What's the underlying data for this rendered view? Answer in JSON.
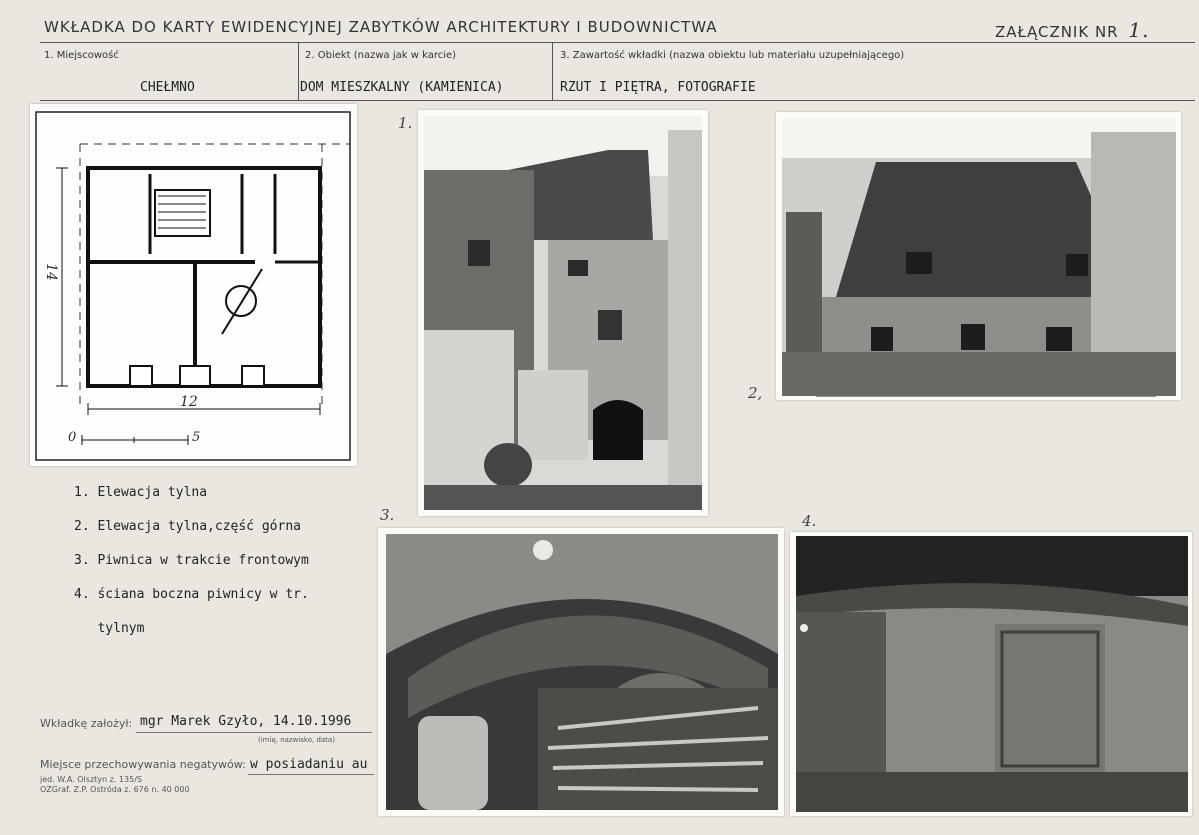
{
  "header": {
    "title": "WKŁADKA DO KARTY EWIDENCYJNEJ ZABYTKÓW ARCHITEKTURY I BUDOWNICTWA",
    "annex_label": "ZAŁĄCZNIK NR",
    "annex_number": "1."
  },
  "fields": {
    "locality_label": "1. Miejscowość",
    "locality_value": "CHEŁMNO",
    "object_label": "2. Obiekt (nazwa jak w karcie)",
    "object_value": "DOM MIESZKALNY (KAMIENICA)",
    "contents_label": "3. Zawartość wkładki (nazwa obiektu lub materiału uzupełniającego)",
    "contents_value": "RZUT I PIĘTRA, FOTOGRAFIE"
  },
  "plan": {
    "dim_vertical": "14",
    "dim_horizontal": "12",
    "scale_start": "0",
    "scale_end": "5"
  },
  "photos": {
    "p1": "1.",
    "p2": "2,",
    "p3": "3.",
    "p4": "4."
  },
  "legend": {
    "items": [
      "1. Elewacja tylna",
      "2. Elewacja tylna,część górna",
      "3. Piwnica w trakcie frontowym",
      "4. ściana boczna piwnicy w tr.",
      "   tylnym"
    ]
  },
  "footer": {
    "author_label": "Wkładkę założył:",
    "author_value": "mgr Marek Gzyło, 14.10.1996",
    "author_hint": "(imię, nazwisko, data)",
    "storage_label": "Miejsce przechowywania negatywów:",
    "storage_value": "w posiadaniu au",
    "print_line1": "jed. W.A. Olsztyn z. 135/S",
    "print_line2": "OZGraf. Z.P. Ostróda z. 676 n. 40 000"
  }
}
